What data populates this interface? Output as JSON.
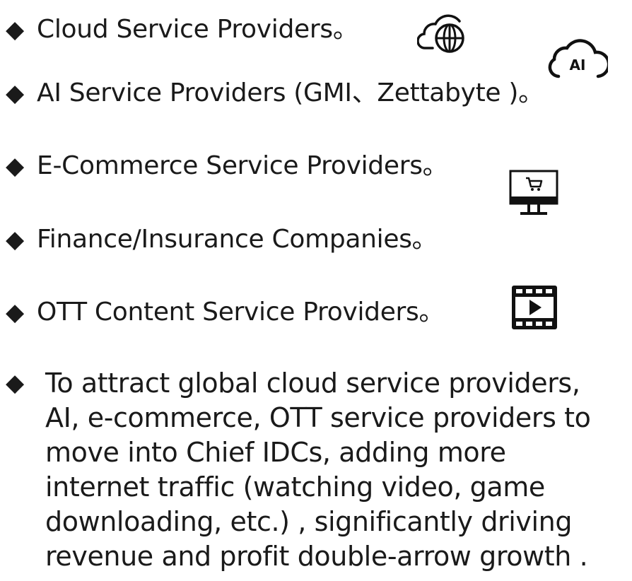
{
  "bullet_glyph": "◆",
  "items": [
    {
      "text": "Cloud Service Providers。",
      "icon": "cloud-globe-icon"
    },
    {
      "text": "AI Service Providers (GMI、Zettabyte )。",
      "icon": "cloud-ai-icon",
      "icon_text": "AI"
    },
    {
      "text": "E-Commerce Service Providers。",
      "icon": "monitor-cart-icon"
    },
    {
      "text": "Finance/Insurance Companies。",
      "icon": ""
    },
    {
      "text": "OTT Content Service Providers。",
      "icon": "video-play-icon"
    }
  ],
  "paragraph": {
    "lines": [
      "To attract global cloud service providers,",
      "AI, e-commerce, OTT service providers to",
      "move into Chief IDCs, adding more",
      "internet traffic (watching video,  game",
      "downloading, etc.) , significantly driving",
      "revenue and profit double-arrow growth ."
    ]
  },
  "colors": {
    "text": "#1a1a1a",
    "background": "#ffffff"
  }
}
